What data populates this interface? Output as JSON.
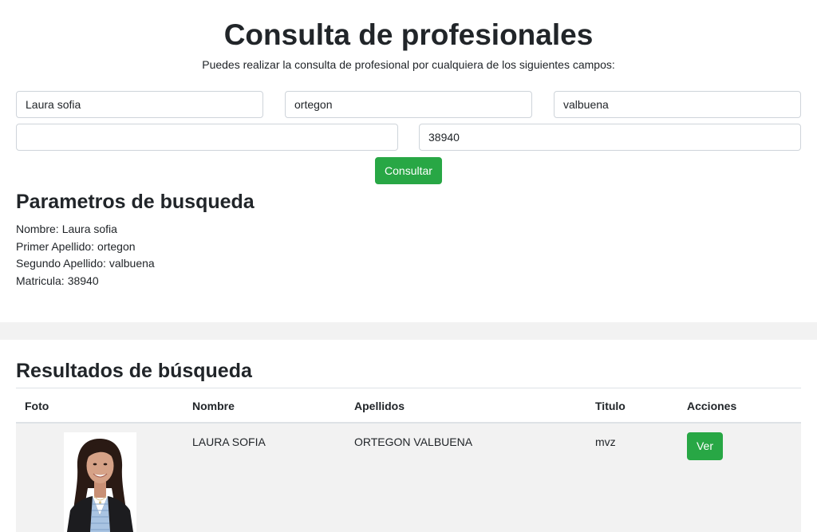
{
  "header": {
    "title": "Consulta de profesionales",
    "subtitle": "Puedes realizar la consulta de profesional por cualquiera de los siguientes campos:"
  },
  "form": {
    "nombre_value": "Laura sofia",
    "primer_apellido_value": "ortegon",
    "segundo_apellido_value": "valbuena",
    "documento_value": "",
    "matricula_value": "38940",
    "submit_label": "Consultar"
  },
  "params": {
    "title": "Parametros de busqueda",
    "items": [
      {
        "label": "Nombre:",
        "value": "Laura sofia"
      },
      {
        "label": "Primer Apellido:",
        "value": "ortegon"
      },
      {
        "label": "Segundo Apellido:",
        "value": "valbuena"
      },
      {
        "label": "Matricula:",
        "value": "38940"
      }
    ]
  },
  "results": {
    "title": "Resultados de búsqueda",
    "columns": [
      "Foto",
      "Nombre",
      "Apellidos",
      "Titulo",
      "Acciones"
    ],
    "rows": [
      {
        "nombre": "LAURA SOFIA",
        "apellidos": "ORTEGON VALBUENA",
        "titulo": "mvz",
        "action_label": "Ver"
      }
    ]
  },
  "colors": {
    "accent_green": "#28a745",
    "row_background": "#f2f2f2",
    "text": "#212529"
  }
}
